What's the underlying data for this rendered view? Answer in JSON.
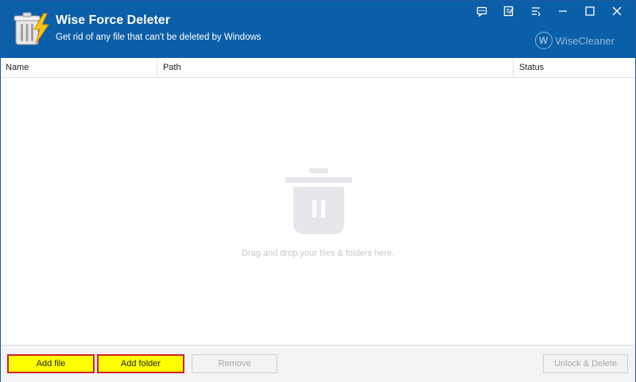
{
  "app": {
    "title": "Wise Force Deleter",
    "subtitle": "Get rid of any file that can't be deleted by Windows",
    "brand_letter": "W",
    "brand_name": "WiseCleaner"
  },
  "title_controls": [
    {
      "name": "feedback-icon"
    },
    {
      "name": "edit-icon"
    },
    {
      "name": "menu-icon"
    },
    {
      "name": "minimize-icon"
    },
    {
      "name": "maximize-icon"
    },
    {
      "name": "close-icon"
    }
  ],
  "table": {
    "columns": [
      "Name",
      "Path",
      "Status"
    ]
  },
  "empty_state": {
    "hint": "Drag and drop your files & folders here."
  },
  "footer": {
    "add_file": "Add file",
    "add_folder": "Add folder",
    "remove": "Remove",
    "unlock_delete": "Unlock & Delete"
  },
  "colors": {
    "header": "#0b5ea8",
    "highlight_fill": "#ffff00",
    "highlight_border": "#d4202a"
  }
}
